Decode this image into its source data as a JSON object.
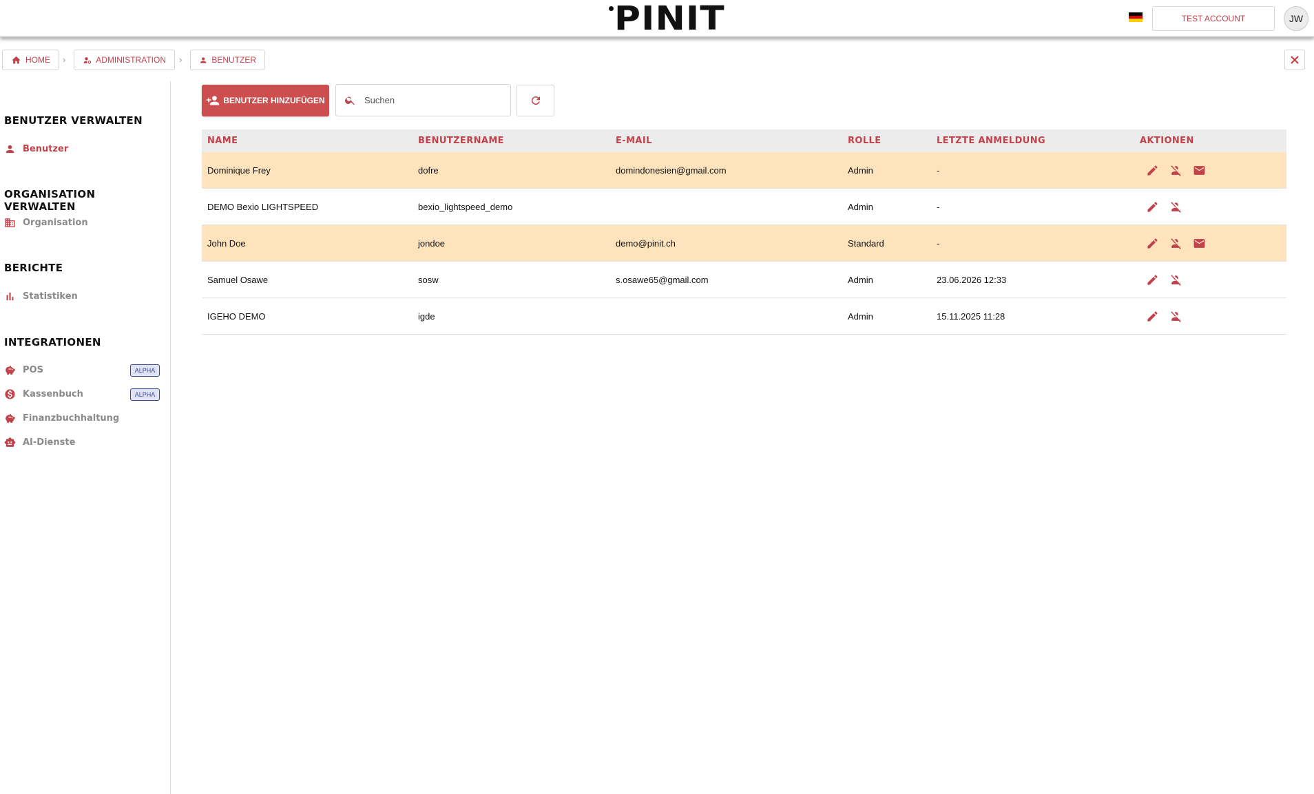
{
  "header": {
    "logo": "PINIT",
    "flag_colors": [
      "#000000",
      "#dd0000",
      "#ffce00"
    ],
    "account_label": "TEST ACCOUNT",
    "avatar_initials": "JW"
  },
  "breadcrumb": {
    "items": [
      {
        "label": "HOME",
        "icon": "home-icon"
      },
      {
        "label": "ADMINISTRATION",
        "icon": "admin-user-icon"
      },
      {
        "label": "BENUTZER",
        "icon": "person-icon"
      }
    ]
  },
  "sidebar": {
    "sections": [
      {
        "title": "BENUTZER VERWALTEN",
        "items": [
          {
            "label": "Benutzer",
            "icon": "person-icon",
            "active": true
          }
        ]
      },
      {
        "title": "ORGANISATION VERWALTEN",
        "items": [
          {
            "label": "Organisation",
            "icon": "building-icon"
          }
        ]
      },
      {
        "title": "BERICHTE",
        "items": [
          {
            "label": "Statistiken",
            "icon": "bar-chart-icon"
          }
        ]
      },
      {
        "title": "INTEGRATIONEN",
        "items": [
          {
            "label": "POS",
            "icon": "piggy-bank-icon",
            "badge": "ALPHA"
          },
          {
            "label": "Kassenbuch",
            "icon": "coin-icon",
            "badge": "ALPHA"
          },
          {
            "label": "Finanzbuchhaltung",
            "icon": "piggy-bank-icon"
          },
          {
            "label": "AI-Dienste",
            "icon": "robot-icon"
          }
        ]
      }
    ]
  },
  "toolbar": {
    "add_label": "BENUTZER HINZUFÜGEN",
    "search_placeholder": "Suchen"
  },
  "table": {
    "headers": [
      "NAME",
      "BENUTZERNAME",
      "E-MAIL",
      "ROLLE",
      "LETZTE ANMELDUNG",
      "AKTIONEN"
    ],
    "rows": [
      {
        "name": "Dominique Frey",
        "username": "dofre",
        "email": "domindonesien@gmail.com",
        "role": "Admin",
        "last_login": "-",
        "highlight": true,
        "mail_action": true
      },
      {
        "name": "DEMO Bexio LIGHTSPEED",
        "username": "bexio_lightspeed_demo",
        "email": "",
        "role": "Admin",
        "last_login": "-",
        "highlight": false,
        "mail_action": false
      },
      {
        "name": "John Doe",
        "username": "jondoe",
        "email": "demo@pinit.ch",
        "role": "Standard",
        "last_login": "-",
        "highlight": true,
        "mail_action": true
      },
      {
        "name": "Samuel Osawe",
        "username": "sosw",
        "email": "s.osawe65@gmail.com",
        "role": "Admin",
        "last_login": "23.06.2026 12:33",
        "highlight": false,
        "mail_action": false
      },
      {
        "name": "IGEHO DEMO",
        "username": "igde",
        "email": "",
        "role": "Admin",
        "last_login": "15.11.2025 11:28",
        "highlight": false,
        "mail_action": false
      }
    ]
  },
  "colors": {
    "accent": "#c0424b",
    "button": "#cd4e4e",
    "row_highlight": "#fee3bc",
    "badge_bg": "#dfe3f5"
  }
}
